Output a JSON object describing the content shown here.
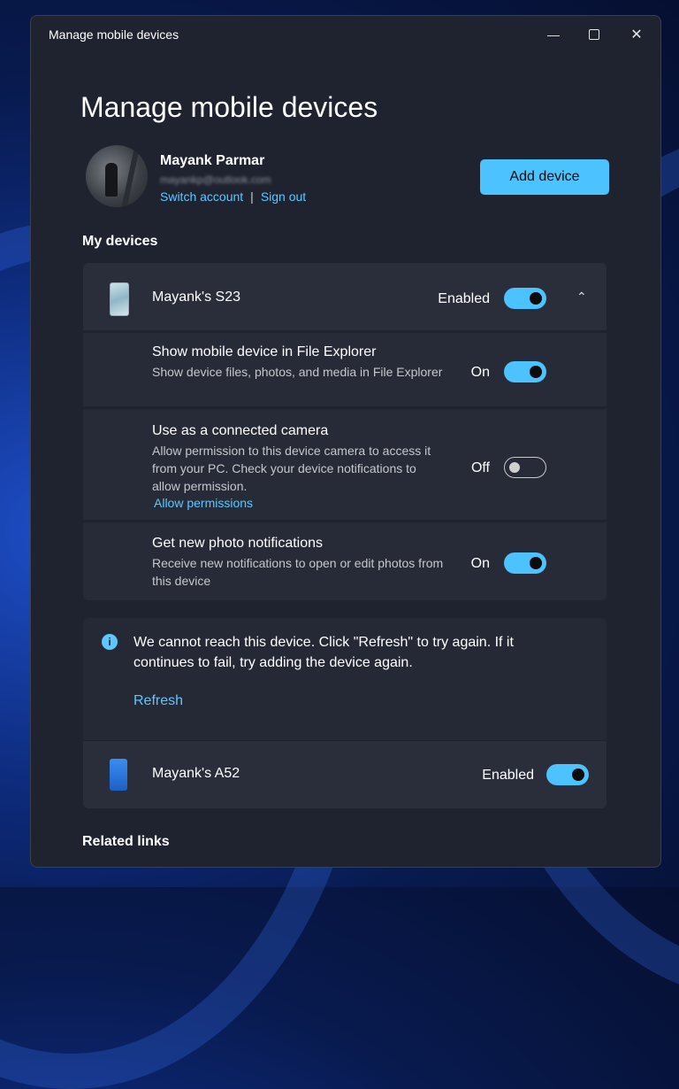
{
  "window": {
    "title": "Manage mobile devices"
  },
  "page": {
    "heading": "Manage mobile devices"
  },
  "account": {
    "name": "Mayank Parmar",
    "email": "mayankp@outlook.com",
    "switch_label": "Switch account",
    "separator": "|",
    "signout_label": "Sign out",
    "add_device_label": "Add device"
  },
  "sections": {
    "my_devices": "My devices",
    "related_links": "Related links"
  },
  "devices": [
    {
      "name": "Mayank's S23",
      "state_label": "Enabled",
      "toggle_on": true,
      "expanded": true,
      "options": [
        {
          "title": "Show mobile device in File Explorer",
          "description": "Show device files, photos, and media in File Explorer",
          "state_label": "On",
          "toggle_on": true
        },
        {
          "title": "Use as a connected camera",
          "description": "Allow permission to this device camera to access it from your PC. Check your device notifications to allow permission.",
          "link": "Allow permissions",
          "state_label": "Off",
          "toggle_on": false
        },
        {
          "title": "Get new photo notifications",
          "description": "Receive new notifications to open or edit photos from this device",
          "state_label": "On",
          "toggle_on": true
        }
      ],
      "warning": {
        "message": "We cannot reach this device. Click \"Refresh\" to try again. If it continues to fail, try adding the device again.",
        "action": "Refresh"
      }
    },
    {
      "name": "Mayank's A52",
      "state_label": "Enabled",
      "toggle_on": true
    }
  ],
  "colors": {
    "accent": "#4cc2ff",
    "link": "#5cc8ff",
    "window_bg": "#1f2330",
    "card_bg": "#2a2e3b"
  },
  "icons": {
    "minimize": "minimize-icon",
    "maximize": "maximize-icon",
    "close": "close-icon",
    "chevron": "chevron-up-icon",
    "info": "info-icon"
  }
}
